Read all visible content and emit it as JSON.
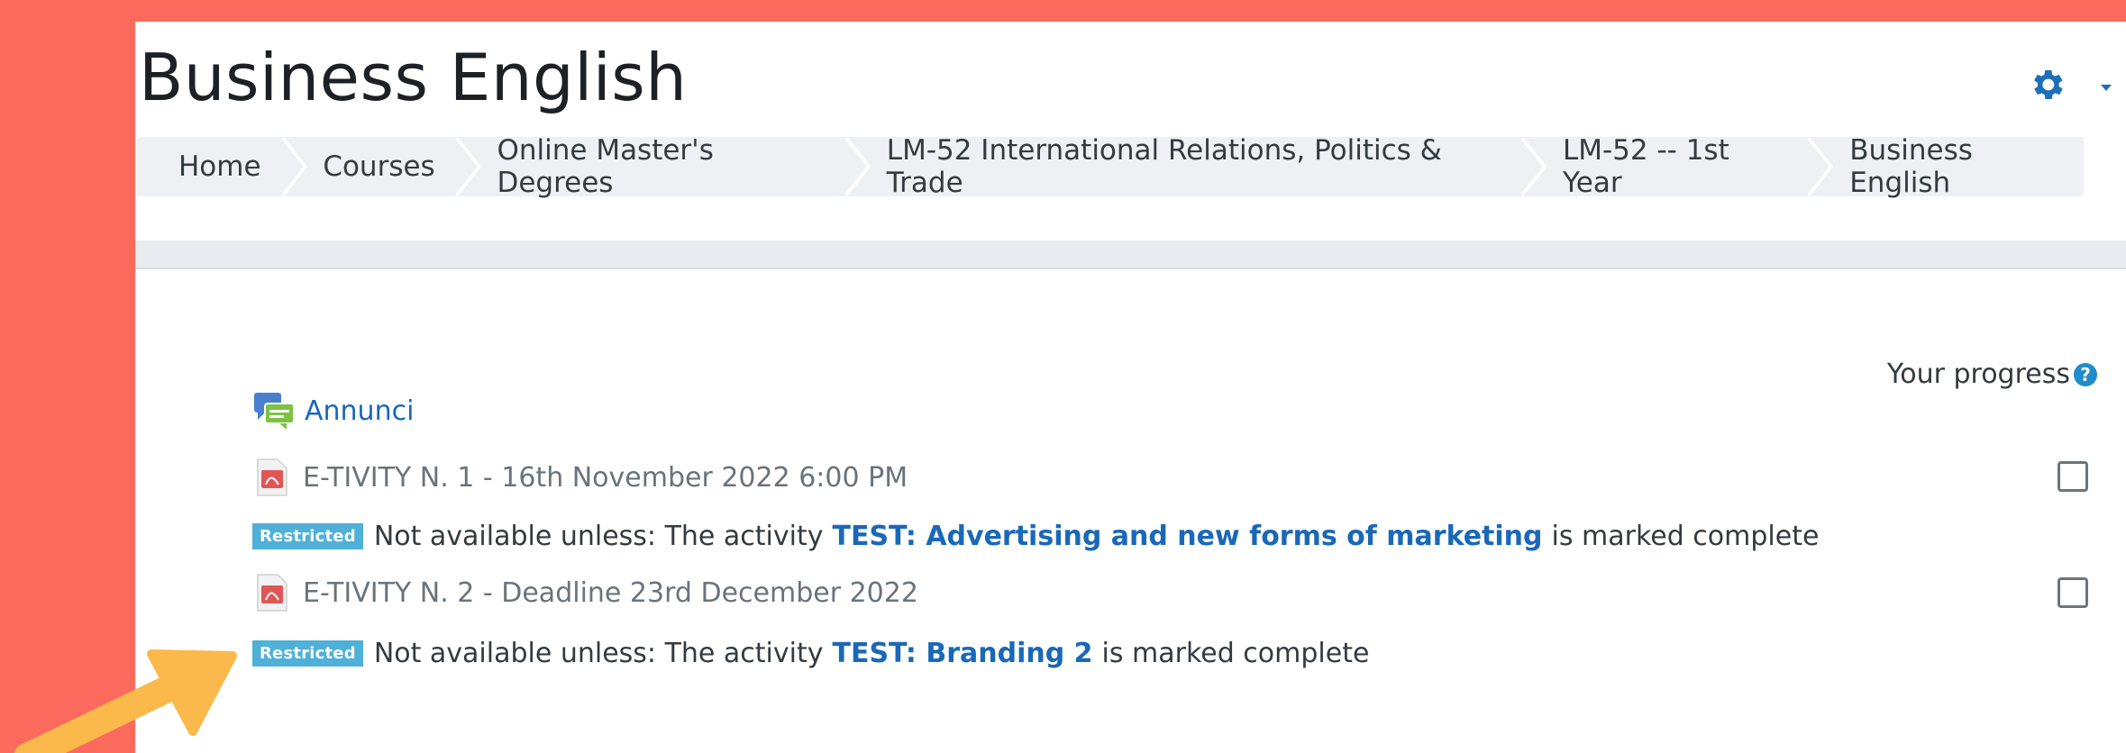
{
  "page": {
    "title": "Business English"
  },
  "breadcrumb": [
    {
      "label": "Home"
    },
    {
      "label": "Courses"
    },
    {
      "label": "Online Master's Degrees"
    },
    {
      "label": "LM-52 International Relations, Politics & Trade"
    },
    {
      "label": "LM-52 -- 1st Year"
    },
    {
      "label": "Business English"
    }
  ],
  "progress": {
    "label": "Your progress",
    "help_icon": "?"
  },
  "activities": {
    "announcements": {
      "label": "Annunci",
      "icon": "forum-icon"
    },
    "etivity1": {
      "label": "E-TIVITY N. 1 - 16th November 2022 6:00 PM",
      "icon": "pdf-icon",
      "completed": false
    },
    "restriction1": {
      "badge": "Restricted",
      "prefix": "Not available unless: The activity",
      "activity": "TEST: Advertising and new forms of marketing",
      "suffix": "is marked complete"
    },
    "etivity2": {
      "label": "E-TIVITY N. 2 - Deadline 23rd December 2022",
      "icon": "pdf-icon",
      "completed": false
    },
    "restriction2": {
      "badge": "Restricted",
      "prefix": "Not available unless: The activity",
      "activity": "TEST: Branding 2",
      "suffix": "is marked complete"
    }
  },
  "colors": {
    "background": "#fb6a5c",
    "link": "#1a68b8",
    "badge": "#4fb0d8",
    "arrow": "#fbb84b"
  }
}
